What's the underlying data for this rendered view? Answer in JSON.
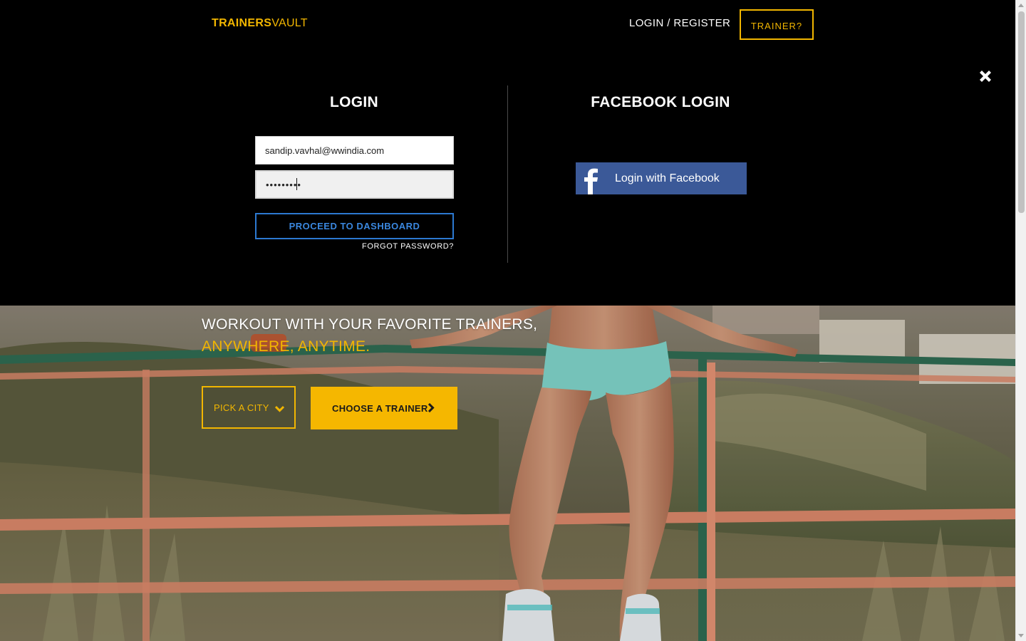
{
  "header": {
    "logo_bold": "TRAINERS",
    "logo_thin": "VAULT",
    "login_register": "LOGIN / REGISTER",
    "trainer_button": "TRAINER?"
  },
  "login": {
    "title": "LOGIN",
    "email_value": "sandip.vavhal@wwindia.com",
    "password_masked": "•••••••••",
    "proceed_label": "PROCEED TO DASHBOARD",
    "forgot_label": "FORGOT PASSWORD?"
  },
  "facebook": {
    "title": "FACEBOOK LOGIN",
    "button_label": "Login with Facebook",
    "icon": "facebook-f-icon"
  },
  "overlay": {
    "close_icon": "close-icon"
  },
  "hero": {
    "headline": "WORKOUT WITH YOUR FAVORITE TRAINERS,",
    "subline": "ANYWHERE, ANYTIME.",
    "pick_city_label": "PICK A CITY",
    "choose_trainer_label": "CHOOSE A TRAINER"
  },
  "colors": {
    "accent": "#f2b600",
    "button_blue": "#2c79d1",
    "facebook": "#3b5998",
    "background": "#000000"
  }
}
